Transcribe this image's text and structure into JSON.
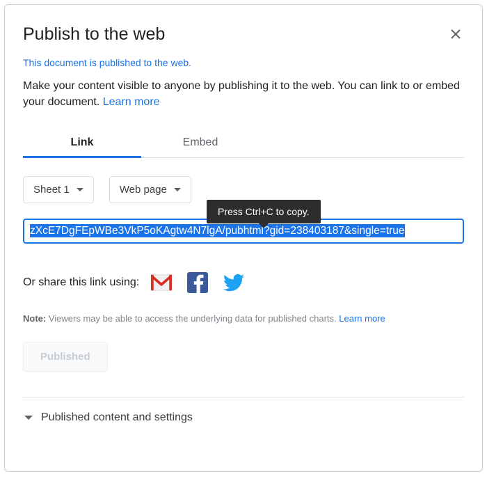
{
  "header": {
    "title": "Publish to the web"
  },
  "status_link": "This document is published to the web.",
  "description": {
    "text_before": "Make your content visible to anyone by publishing it to the web. You can link to or embed your document. ",
    "learn_more": "Learn more"
  },
  "tabs": {
    "link": "Link",
    "embed": "Embed",
    "active": "link"
  },
  "selects": {
    "sheet": "Sheet 1",
    "format": "Web page"
  },
  "tooltip": "Press Ctrl+C to copy.",
  "url_value": "zXcE7DgFEpWBe3VkP5oKAgtw4N7lgA/pubhtml?gid=238403187&single=true",
  "share": {
    "label": "Or share this link using:",
    "gmail_icon": "gmail-icon",
    "facebook_icon": "facebook-icon",
    "twitter_icon": "twitter-icon"
  },
  "note": {
    "prefix": "Note:",
    "text": " Viewers may be able to access the underlying data for published charts. ",
    "learn_more": "Learn more"
  },
  "published_button": "Published",
  "expander_label": "Published content and settings"
}
